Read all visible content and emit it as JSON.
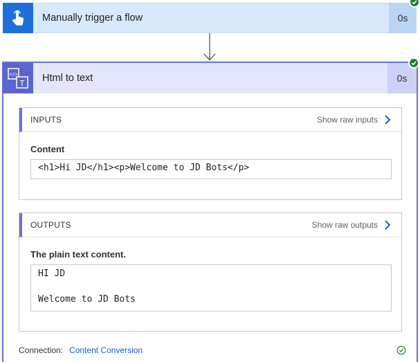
{
  "trigger": {
    "title": "Manually trigger a flow",
    "duration": "0s",
    "icon": "touch-hand-icon",
    "status": "succeeded"
  },
  "action": {
    "title": "Html to text",
    "duration": "0s",
    "icon": "html-to-text-icon",
    "status": "succeeded",
    "inputs": {
      "header": "INPUTS",
      "show_raw": "Show raw inputs",
      "field_label": "Content",
      "field_value": "<h1>Hi JD</h1><p>Welcome to JD Bots</p>"
    },
    "outputs": {
      "header": "OUTPUTS",
      "show_raw": "Show raw outputs",
      "field_label": "The plain text content.",
      "field_value": "HI JD\n\nWelcome to JD Bots"
    },
    "connection": {
      "label": "Connection:",
      "name": "Content Conversion"
    }
  },
  "colors": {
    "trigger_accent": "#1f6fd9",
    "action_accent": "#5b65cf",
    "success": "#16812a",
    "link": "#0f62c4"
  }
}
